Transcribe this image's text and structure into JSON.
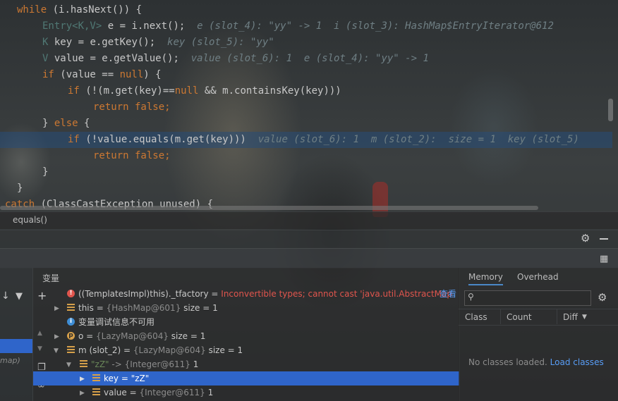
{
  "editor": {
    "lines": [
      {
        "pre": "",
        "kw1": "while",
        "code": " (i.hasNext()) {",
        "hint": ""
      },
      {
        "pre": "    ",
        "type": "Entry<K,V>",
        "code": " e = i.next();",
        "hint": "  e (slot_4): \"yy\" -> 1  i (slot_3): HashMap$EntryIterator@612"
      },
      {
        "pre": "    ",
        "type": "K",
        "code": " key = e.getKey();",
        "hint": "  key (slot_5): \"yy\""
      },
      {
        "pre": "    ",
        "type": "V",
        "code": " value = e.getValue();",
        "hint": "  value (slot_6): 1  e (slot_4): \"yy\" -> 1"
      },
      {
        "pre": "    ",
        "kw1": "if",
        "code": " (value == ",
        "kw2": "null",
        "tail": ") {",
        "hint": ""
      },
      {
        "pre": "        ",
        "kw1": "if",
        "code": " (!(m.get(key)==",
        "kw2": "null",
        "tail": " && m.containsKey(key)))",
        "hint": ""
      },
      {
        "pre": "            ",
        "kw1": "return false;",
        "code": "",
        "hint": ""
      },
      {
        "pre": "    ",
        "code": "} ",
        "kw2": "else",
        "tail": " {",
        "hint": ""
      },
      {
        "pre": "        ",
        "kw1": "if",
        "code": " (!value.equals(m.get(key)))",
        "hint": "  value (slot_6): 1  m (slot_2):  size = 1  key (slot_5)"
      },
      {
        "pre": "            ",
        "kw1": "return false;",
        "code": "",
        "hint": ""
      },
      {
        "pre": "    ",
        "code": "}",
        "hint": ""
      },
      {
        "pre": "  ",
        "code": "}",
        "hint": ""
      },
      {
        "pre": "",
        "kw1": "catch",
        "code": " (ClassCastException unused) {",
        "hint": ""
      }
    ]
  },
  "breadcrumb": "equals()",
  "variables": {
    "title": "变量",
    "items": [
      {
        "name": "((TemplatesImpl)this)._tfactory",
        "eq": " = ",
        "value": "Inconvertible types; cannot cast 'java.util.AbstractMap",
        "extra": "查看"
      },
      {
        "name": "this",
        "eq": " = ",
        "value": "{HashMap@601}",
        "extra": "  size = 1"
      },
      {
        "name": "变量调试信息不可用",
        "eq": "",
        "value": "",
        "extra": ""
      },
      {
        "name": "o",
        "eq": " = ",
        "value": "{LazyMap@604}",
        "extra": "  size = 1"
      },
      {
        "name": "m (slot_2)",
        "eq": " = ",
        "value": "{LazyMap@604}",
        "extra": "  size = 1"
      },
      {
        "name": "\"zZ\"",
        "eq": " -> ",
        "value": "{Integer@611}",
        "extra": " 1"
      },
      {
        "name": "key",
        "eq": " = ",
        "value": "\"zZ\"",
        "extra": ""
      },
      {
        "name": "value",
        "eq": " = ",
        "value": "{Integer@611}",
        "extra": " 1"
      }
    ]
  },
  "frames": {
    "italic_label": "map)"
  },
  "memory": {
    "tabs": [
      "Memory",
      "Overhead"
    ],
    "columns": [
      "Class",
      "Count",
      "Diff"
    ],
    "empty_text": "No classes loaded.",
    "load_link": "Load classes"
  }
}
